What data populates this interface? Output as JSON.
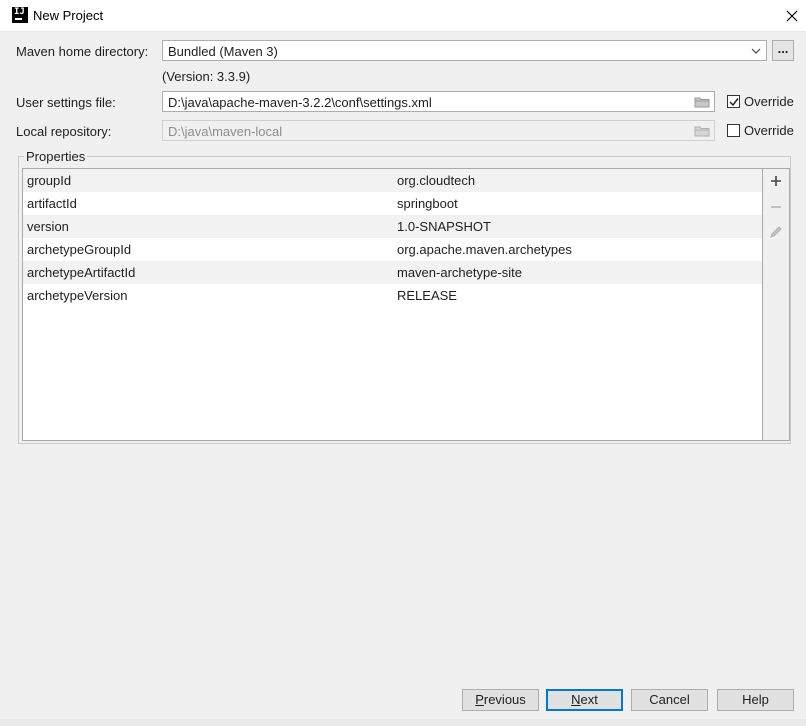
{
  "window": {
    "title": "New Project",
    "app_icon": "intellij-icon"
  },
  "form": {
    "maven_home_label": "Maven home directory:",
    "maven_home_value": "Bundled (Maven 3)",
    "maven_version": "(Version: 3.3.9)",
    "browse_button_label": "...",
    "user_settings_label": "User settings file:",
    "user_settings_value": "D:\\java\\apache-maven-3.2.2\\conf\\settings.xml",
    "user_settings_override_label": "Override",
    "user_settings_override_checked": true,
    "local_repo_label": "Local repository:",
    "local_repo_value": "D:\\java\\maven-local",
    "local_repo_override_label": "Override",
    "local_repo_override_checked": false
  },
  "properties": {
    "title": "Properties",
    "rows": [
      {
        "key": "groupId",
        "value": "org.cloudtech"
      },
      {
        "key": "artifactId",
        "value": "springboot"
      },
      {
        "key": "version",
        "value": "1.0-SNAPSHOT"
      },
      {
        "key": "archetypeGroupId",
        "value": "org.apache.maven.archetypes"
      },
      {
        "key": "archetypeArtifactId",
        "value": "maven-archetype-site"
      },
      {
        "key": "archetypeVersion",
        "value": "RELEASE"
      }
    ],
    "tools": [
      "plus-icon",
      "minus-icon",
      "pencil-icon"
    ]
  },
  "buttons": {
    "previous_mnemonic": "P",
    "previous_rest": "revious",
    "next_mnemonic": "N",
    "next_rest": "ext",
    "cancel": "Cancel",
    "help": "Help"
  },
  "colors": {
    "default_button_border": "#0078d7",
    "dialog_background": "#f0f0f0"
  }
}
